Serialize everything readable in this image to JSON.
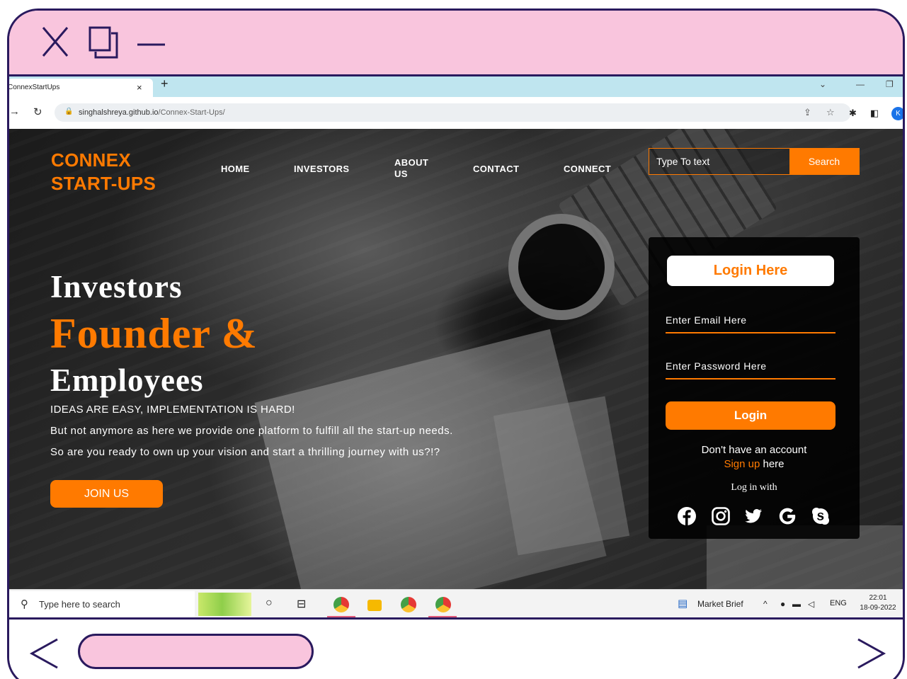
{
  "browser": {
    "tab_title": "ConnexStartUps",
    "tab_close": "×",
    "new_tab": "+",
    "url_host": "singhalshreya.github.io",
    "url_path": "/Connex-Start-Ups/"
  },
  "site": {
    "logo_line1": "CONNEX",
    "logo_line2": "START-UPS",
    "nav": {
      "home": "HOME",
      "investors": "INVESTORS",
      "about_line1": "ABOUT",
      "about_line2": "US",
      "contact": "CONTACT",
      "connect": "CONNECT"
    },
    "search": {
      "placeholder": "Type To text",
      "button": "Search"
    },
    "hero": {
      "line1": "Investors",
      "line2": "Founder &",
      "line3": "Employees",
      "tagline": "IDEAS ARE EASY, IMPLEMENTATION IS HARD!",
      "desc1": "But not anymore as here we provide one platform to fulfill all the start-up needs.",
      "desc2": "So are you ready to own up your vision and start a thrilling journey with us?!?",
      "join_button": "JOIN US"
    },
    "login": {
      "title": "Login Here",
      "email_placeholder": "Enter Email Here",
      "password_placeholder": "Enter Password Here",
      "button": "Login",
      "no_account": "Don't have an account",
      "signup_link": "Sign up",
      "signup_rest": " here",
      "login_with": "Log in with",
      "social_icons": [
        "facebook-icon",
        "instagram-icon",
        "twitter-icon",
        "google-icon",
        "skype-icon"
      ]
    },
    "colors": {
      "accent": "#ff7a00",
      "frame": "#2a1a5e",
      "frame_fill": "#f9c5dd",
      "tabbar": "#bfe5ef"
    }
  },
  "taskbar": {
    "search_placeholder": "Type here to search",
    "market": "Market Brief",
    "language": "ENG",
    "time": "22:01",
    "date": "18-09-2022"
  }
}
